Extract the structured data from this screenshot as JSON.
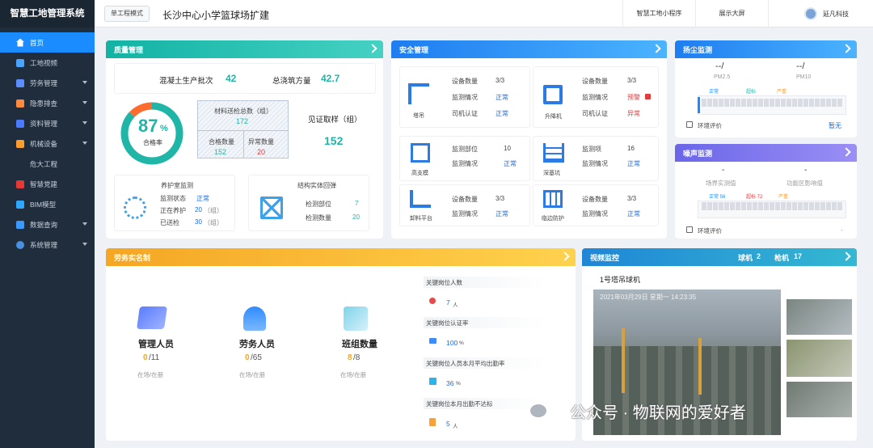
{
  "app": {
    "title": "智慧工地管理系统"
  },
  "sidebar": {
    "items": [
      {
        "label": "首页",
        "active": true
      },
      {
        "label": "工地视频"
      },
      {
        "label": "劳务管理"
      },
      {
        "label": "隐患排查"
      },
      {
        "label": "资料管理"
      },
      {
        "label": "机械设备"
      },
      {
        "label": "危大工程"
      },
      {
        "label": "智慧党建"
      },
      {
        "label": "BIM模型"
      },
      {
        "label": "数据查询"
      },
      {
        "label": "系统管理"
      }
    ]
  },
  "topbar": {
    "mode_button": "单工程模式",
    "project_title": "长沙中心小学篮球场扩建",
    "links": [
      "智慧工地小程序",
      "展示大屏"
    ],
    "user": "延凡科技"
  },
  "quality": {
    "title": "质量管理",
    "concrete_label": "混凝土生产批次",
    "concrete_value": "42",
    "pour_label": "总浇筑方量",
    "pour_value": "42.7",
    "pass_rate_value": "87",
    "pass_rate_unit": "%",
    "pass_rate_label": "合格率",
    "pass_rate_fraction": 0.87,
    "materials_label": "材料送检总数（组）",
    "materials_value": "172",
    "qualified_label": "合格数量",
    "qualified_value": "152",
    "abnormal_label": "异常数量",
    "abnormal_value": "20",
    "witness_label": "见证取样（组）",
    "witness_value": "152",
    "curing_title": "养护室监测",
    "curing_rows": [
      {
        "label": "监测状态",
        "value": "正常",
        "unit": ""
      },
      {
        "label": "正在养护",
        "value": "20",
        "unit": "（组）"
      },
      {
        "label": "已送检",
        "value": "30",
        "unit": "（组）"
      }
    ],
    "rebound_title": "结构实体回弹",
    "rebound_rows": [
      {
        "label": "检测部位",
        "value": "7"
      },
      {
        "label": "检测数量",
        "value": "20"
      }
    ]
  },
  "safety": {
    "title": "安全管理",
    "tower": {
      "name": "塔吊",
      "r1l": "设备数量",
      "r1v": "3/3",
      "r2l": "监测情况",
      "r2v": "正常",
      "r3l": "司机认证",
      "r3v": "正常"
    },
    "lift": {
      "name": "升降机",
      "r1l": "设备数量",
      "r1v": "3/3",
      "r2l": "监测情况",
      "r2v": "预警",
      "r3l": "司机认证",
      "r3v": "异常"
    },
    "formwork": {
      "name": "高支模",
      "r1l": "监测部位",
      "r1v": "10",
      "r2l": "监测情况",
      "r2v": "正常"
    },
    "pit": {
      "name": "深基坑",
      "r1l": "监测项",
      "r1v": "16",
      "r2l": "监测情况",
      "r2v": "正常"
    },
    "platform": {
      "name": "卸料平台",
      "r1l": "设备数量",
      "r1v": "3/3",
      "r2l": "监测情况",
      "r2v": "正常"
    },
    "edge": {
      "name": "临边防护",
      "r1l": "设备数量",
      "r1v": "3/3",
      "r2l": "监测情况",
      "r2v": "正常"
    }
  },
  "dust": {
    "title": "扬尘监测",
    "pm25_value": "--/",
    "pm25_label": "PM2.5",
    "pm10_value": "--/",
    "pm10_label": "PM10",
    "legend": [
      "正常",
      "超标",
      "严重"
    ],
    "footer_label": "环境评价",
    "footer_value": "暂无"
  },
  "noise": {
    "title": "噪声监测",
    "v1": "-",
    "l1": "场界实测值",
    "v2": "-",
    "l2": "功能区影响值",
    "legend": [
      "正常 56",
      "超标 72",
      "严重"
    ],
    "footer_label": "环境评价",
    "footer_value": "-"
  },
  "labor": {
    "title": "劳务实名制",
    "groups": [
      {
        "name": "管理人员",
        "onsite": "0",
        "total": "/11",
        "sub": "在场/在册"
      },
      {
        "name": "劳务人员",
        "onsite": "0",
        "total": "/65",
        "sub": "在场/在册"
      },
      {
        "name": "班组数量",
        "onsite": "8",
        "total": "/8",
        "sub": "在场/在册"
      }
    ],
    "stats": [
      {
        "label": "关键岗位人数",
        "value": "7",
        "unit": "人"
      },
      {
        "label": "关键岗位认证率",
        "value": "100",
        "unit": "%"
      },
      {
        "label": "关键岗位人员本月平均出勤率",
        "value": "36",
        "unit": "%"
      },
      {
        "label": "关键岗位本月出勤不达标",
        "value": "5",
        "unit": "人"
      }
    ]
  },
  "video": {
    "title": "视频监控",
    "tower_label": "球机",
    "tower_count": "2",
    "gun_label": "枪机",
    "gun_count": "17",
    "camera_name": "1号塔吊球机",
    "timestamp": "2021年03月29日  星期一  14:23:35",
    "watermark": "公众号 · 物联网的爱好者"
  },
  "colors": {
    "primary": "#1a8cff",
    "sidebar": "#1f2d3d",
    "teal": "#1fb5a7",
    "accent_red": "#e23b3b"
  }
}
